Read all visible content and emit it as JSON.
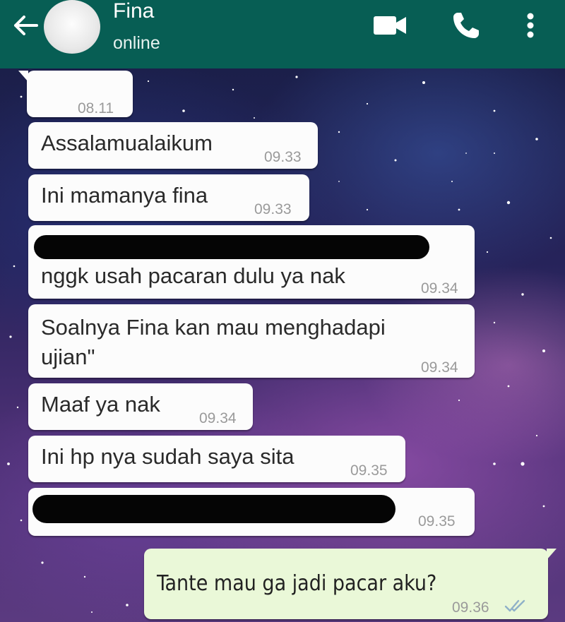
{
  "header": {
    "contact_name": "Fina",
    "status": "online",
    "icons": [
      "back-arrow-icon",
      "avatar",
      "video-call-icon",
      "phone-icon",
      "more-vertical-icon"
    ],
    "color": "#075e54"
  },
  "messages": [
    {
      "direction": "in",
      "text": "",
      "time": "08.11"
    },
    {
      "direction": "in",
      "text": "Assalamualaikum",
      "time": "09.33"
    },
    {
      "direction": "in",
      "text": "Ini mamanya fina",
      "time": "09.33"
    },
    {
      "direction": "in",
      "text": "nggk usah pacaran dulu ya nak",
      "time": "09.34",
      "redacted_line": true
    },
    {
      "direction": "in",
      "text": "Soalnya Fina kan mau menghadapi\nujian\"",
      "time": "09.34"
    },
    {
      "direction": "in",
      "text": "Maaf ya nak",
      "time": "09.34"
    },
    {
      "direction": "in",
      "text": "Ini hp nya sudah saya sita",
      "time": "09.35"
    },
    {
      "direction": "in",
      "text": "",
      "time": "09.35",
      "redacted_line": true
    },
    {
      "direction": "out",
      "text": "Tante mau ga jadi pacar aku?",
      "time": "09.36",
      "status_icon": "double-check-icon"
    }
  ],
  "colors": {
    "incoming_bubble": "#fcfcfc",
    "outgoing_bubble": "#eaf8d8",
    "read_ticks": "#8fb1c8"
  }
}
